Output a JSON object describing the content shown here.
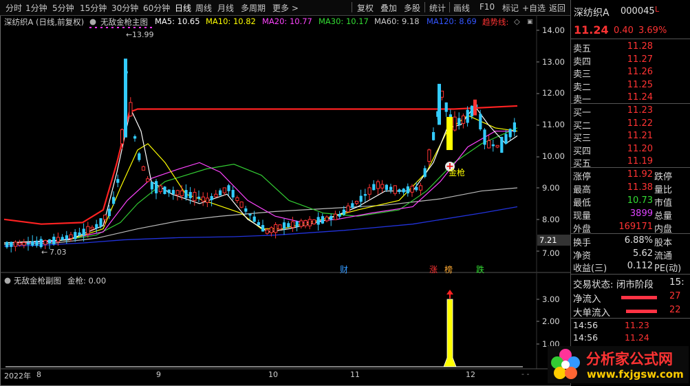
{
  "toolbar": {
    "periods": [
      "分时",
      "1分钟",
      "5分钟",
      "15分钟",
      "30分钟",
      "60分钟",
      "日线",
      "周线",
      "月线",
      "多周期",
      "更多 >"
    ],
    "active": "日线",
    "tools": [
      "复权",
      "叠加",
      "多股",
      "统计",
      "画线",
      "F10",
      "标记",
      "+自选",
      "返回"
    ]
  },
  "main_chart": {
    "title": "深纺织A (日线,前复权)",
    "indicator": "无敌金枪主图",
    "ma": [
      {
        "label": "MA5: 10.65",
        "color": "#ffffff"
      },
      {
        "label": "MA10: 10.82",
        "color": "#ffff00"
      },
      {
        "label": "MA20: 10.77",
        "color": "#ff44ff"
      },
      {
        "label": "MA30: 10.17",
        "color": "#33dd33"
      },
      {
        "label": "MA60: 9.18",
        "color": "#cccccc"
      },
      {
        "label": "MA120: 8.69",
        "color": "#3355ff"
      },
      {
        "label": "趋势线:",
        "color": "#ff3333"
      }
    ],
    "y_ticks": [
      "14.00",
      "13.00",
      "12.00",
      "11.00",
      "10.00",
      "9.00",
      "8.00",
      "7.00"
    ],
    "cursor_price": "7.21",
    "high_mark": "13.99",
    "low_mark": "7.03",
    "signal_label": "金枪",
    "flags": [
      {
        "text": "财",
        "color": "#3399ff"
      },
      {
        "text": "涨",
        "color": "#ff3333"
      },
      {
        "text": "榜",
        "color": "#ffaa33"
      },
      {
        "text": "跌",
        "color": "#33dd33"
      }
    ]
  },
  "sub_chart": {
    "indicator": "无敌金枪副图",
    "value_label": "金枪: 0.00",
    "y_ticks": [
      "3.00",
      "2.00",
      "1.00"
    ]
  },
  "x_axis": {
    "labels": [
      "2022年",
      "8",
      "9",
      "10",
      "11",
      "12"
    ]
  },
  "quote": {
    "name": "深纺织A",
    "code": "000045",
    "badge": "L",
    "price": "11.24",
    "change": "0.40",
    "pct": "3.69%",
    "asks": [
      {
        "label": "卖五",
        "price": "11.28"
      },
      {
        "label": "卖四",
        "price": "11.27"
      },
      {
        "label": "卖三",
        "price": "11.26"
      },
      {
        "label": "卖二",
        "price": "11.25"
      },
      {
        "label": "卖一",
        "price": "11.24"
      }
    ],
    "bids": [
      {
        "label": "买一",
        "price": "11.23"
      },
      {
        "label": "买二",
        "price": "11.22"
      },
      {
        "label": "买三",
        "price": "11.21"
      },
      {
        "label": "买四",
        "price": "11.20"
      },
      {
        "label": "买五",
        "price": "11.19"
      }
    ],
    "stats": [
      {
        "label": "涨停",
        "value": "11.92",
        "color": "#ff3333",
        "label2": "跌停"
      },
      {
        "label": "最高",
        "value": "11.38",
        "color": "#ff3333",
        "label2": "量比"
      },
      {
        "label": "最低",
        "value": "10.73",
        "color": "#33dd33",
        "label2": "市值"
      },
      {
        "label": "现量",
        "value": "3899",
        "color": "#dd44ff",
        "label2": "总量"
      },
      {
        "label": "外盘",
        "value": "169171",
        "color": "#ff3333",
        "label2": "内盘"
      }
    ],
    "stats2": [
      {
        "label": "换手",
        "value": "6.88%",
        "label2": "股本"
      },
      {
        "label": "净资",
        "value": "5.62",
        "label2": "流通"
      },
      {
        "label": "收益(三)",
        "value": "0.112",
        "label2": "PE(动)"
      }
    ],
    "status_label": "交易状态: 闭市阶段",
    "status_time": "15:",
    "flows": [
      {
        "label": "净流入",
        "value": "27"
      },
      {
        "label": "大单流入",
        "value": "22"
      }
    ],
    "ticks": [
      {
        "time": "14:56",
        "price": "11.23"
      },
      {
        "time": "14:56",
        "price": "11.24"
      }
    ]
  },
  "watermark": {
    "title": "分析家公式网",
    "url": "www.fxjgsw.com"
  }
}
